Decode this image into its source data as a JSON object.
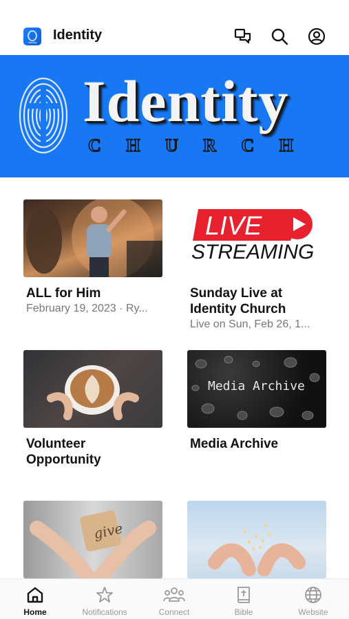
{
  "header": {
    "app_icon_text": "Identity",
    "title": "Identity",
    "icons": [
      "chat-icon",
      "search-icon",
      "account-icon"
    ]
  },
  "banner": {
    "title": "Identity",
    "subtitle": [
      "C",
      "H",
      "U",
      "R",
      "C",
      "H"
    ]
  },
  "cards": [
    {
      "title": "ALL for Him",
      "subtitle": "February 19, 2023 · Ry..."
    },
    {
      "title": "Sunday Live at Identity Church",
      "subtitle": "Live on Sun, Feb 26, 1...",
      "thumb_text_1": "LIVE",
      "thumb_text_2": "STREAMING"
    },
    {
      "title": "Volunteer Opportunity",
      "subtitle": ""
    },
    {
      "title": "Media Archive",
      "subtitle": "",
      "thumb_text": "Media Archive"
    },
    {
      "title": "",
      "subtitle": "",
      "thumb_text": "give"
    },
    {
      "title": "",
      "subtitle": ""
    }
  ],
  "nav": [
    {
      "label": "Home",
      "icon": "home-icon",
      "active": true
    },
    {
      "label": "Notifications",
      "icon": "star-icon",
      "active": false
    },
    {
      "label": "Connect",
      "icon": "people-icon",
      "active": false
    },
    {
      "label": "Bible",
      "icon": "bible-icon",
      "active": false
    },
    {
      "label": "Website",
      "icon": "globe-icon",
      "active": false
    }
  ],
  "colors": {
    "brand": "#1877f2",
    "live_red": "#e8212e",
    "active": "#111111",
    "inactive": "#999999"
  }
}
